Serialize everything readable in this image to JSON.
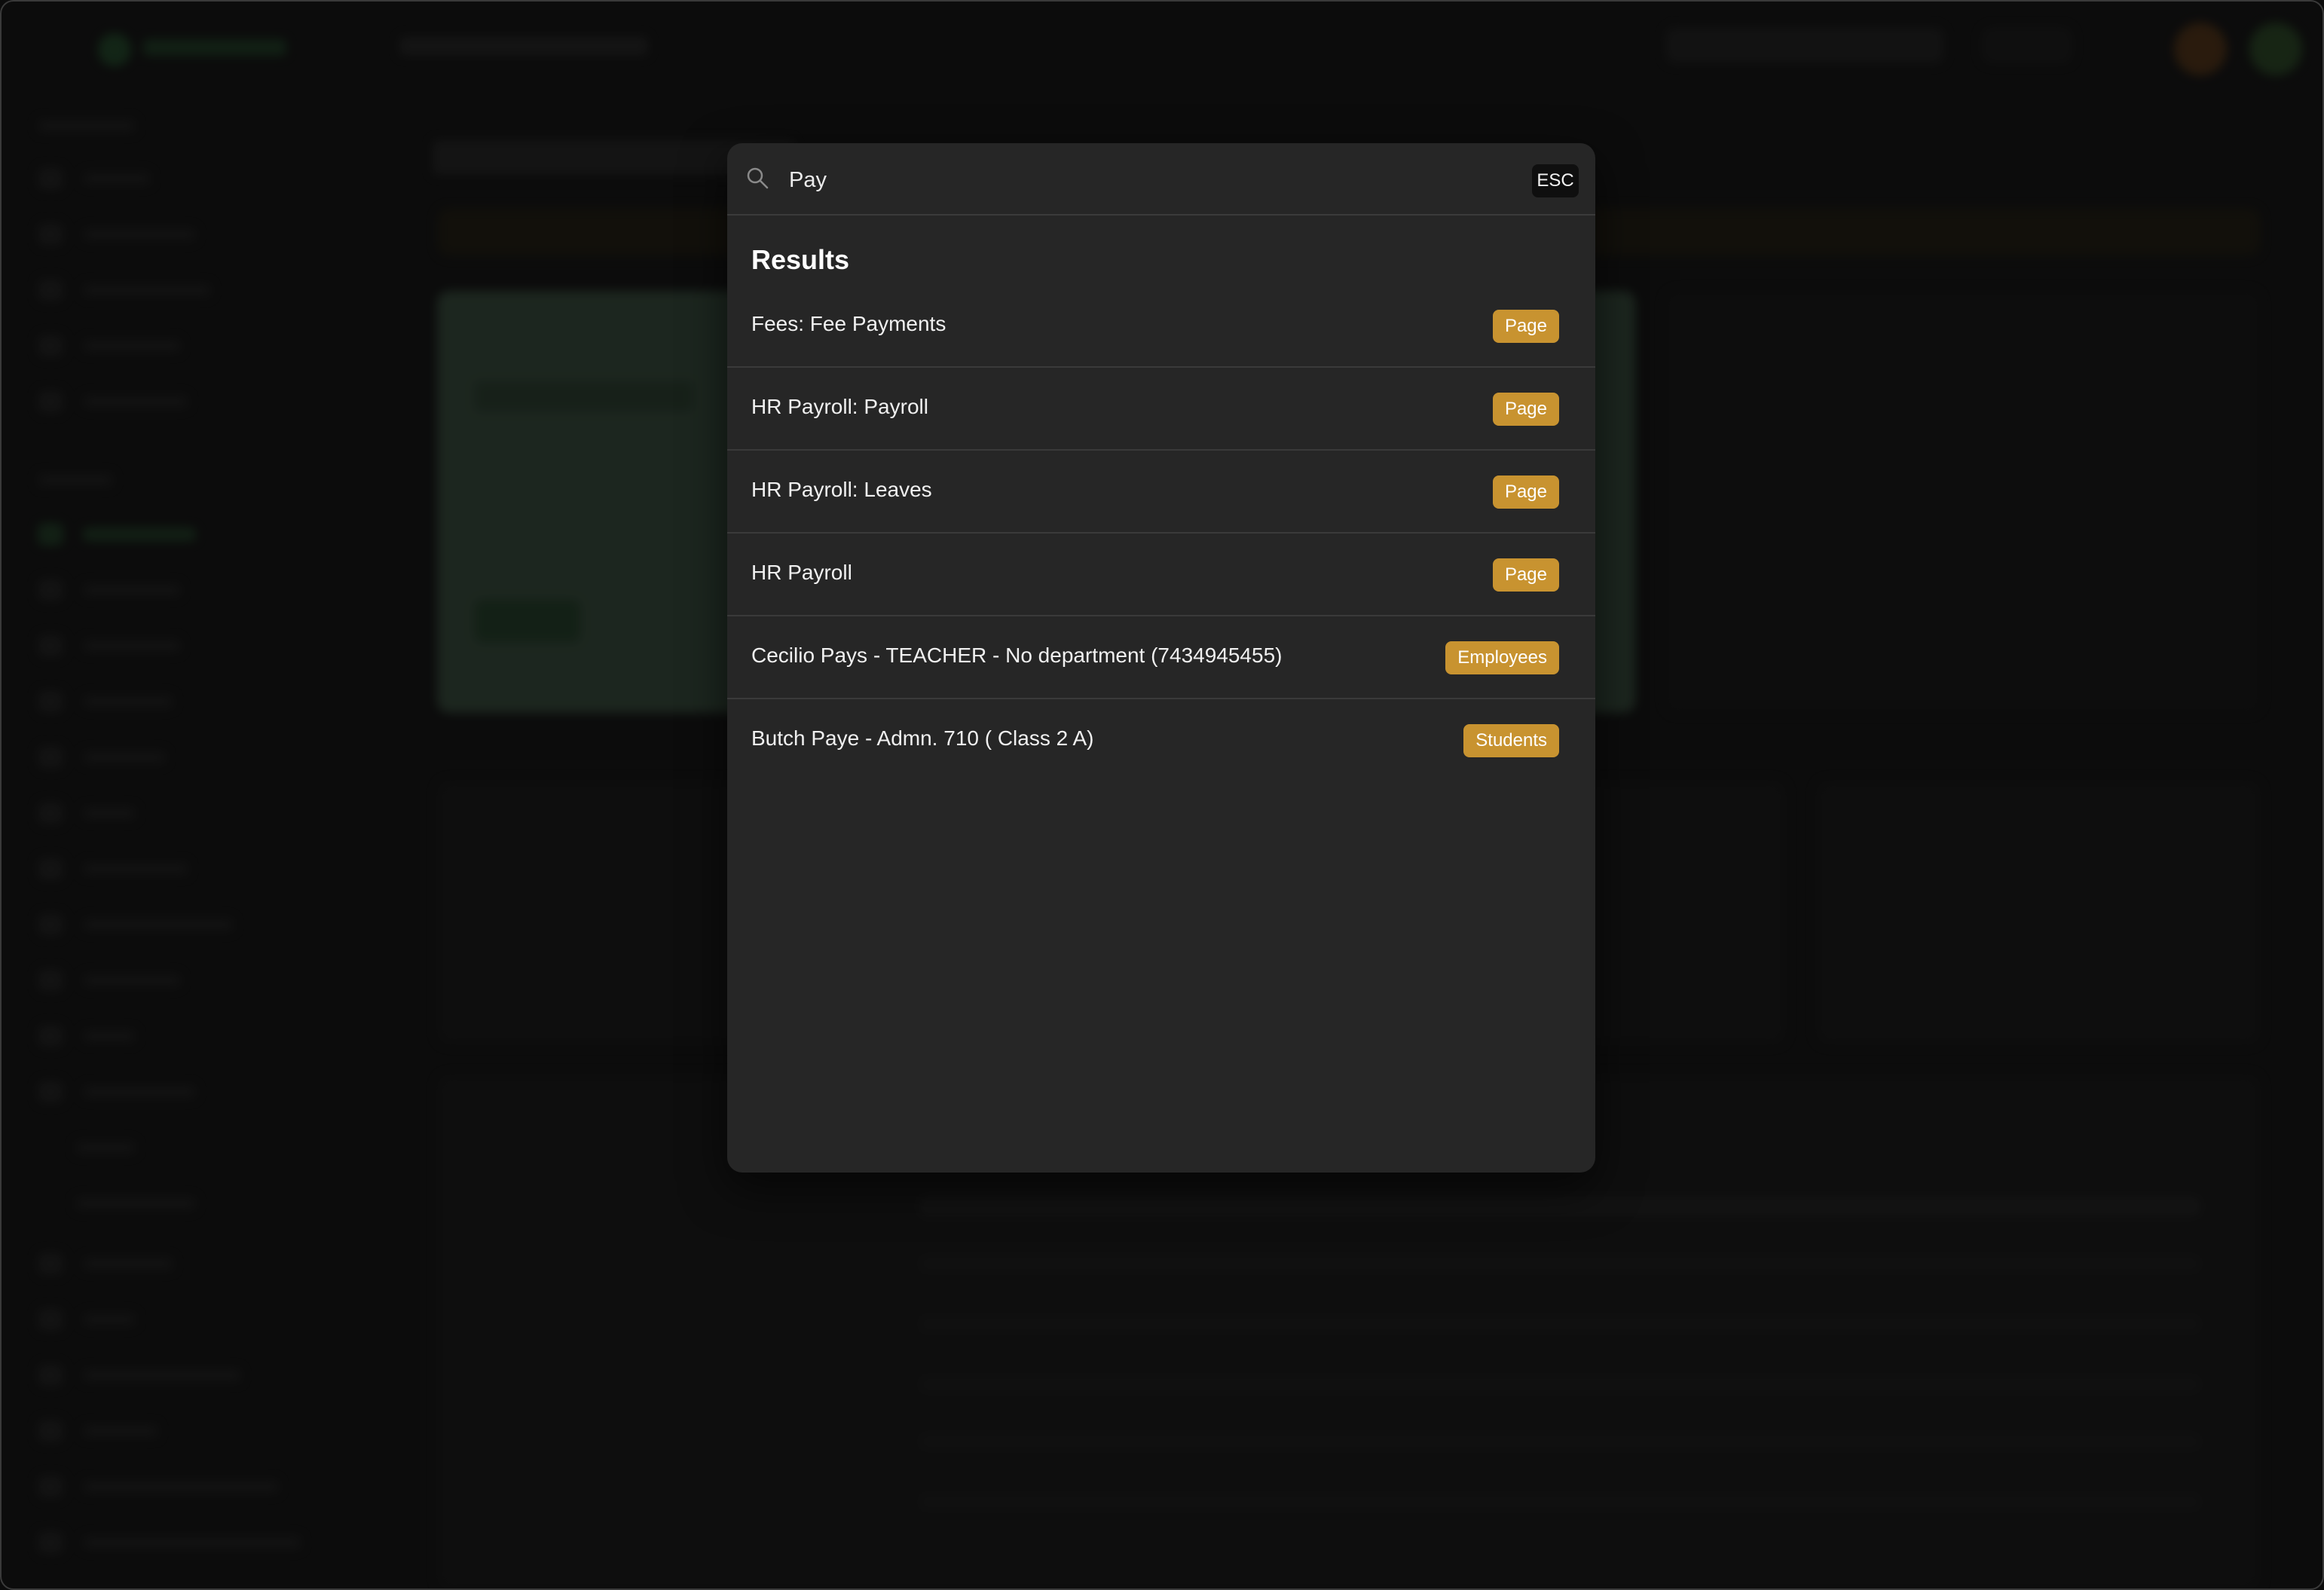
{
  "search": {
    "value": "Pay",
    "esc_label": "ESC"
  },
  "results": {
    "heading": "Results",
    "items": [
      {
        "label": "Fees: Fee Payments",
        "badge": "Page"
      },
      {
        "label": "HR Payroll: Payroll",
        "badge": "Page"
      },
      {
        "label": "HR Payroll: Leaves",
        "badge": "Page"
      },
      {
        "label": "HR Payroll",
        "badge": "Page"
      },
      {
        "label": "Cecilio Pays - TEACHER - No department (7434945455)",
        "badge": "Employees"
      },
      {
        "label": "Butch Paye - Admn. 710 ( Class 2 A)",
        "badge": "Students"
      }
    ]
  },
  "colors": {
    "badge": "#c89330",
    "modal_bg": "#262626",
    "backdrop": "#161616"
  }
}
